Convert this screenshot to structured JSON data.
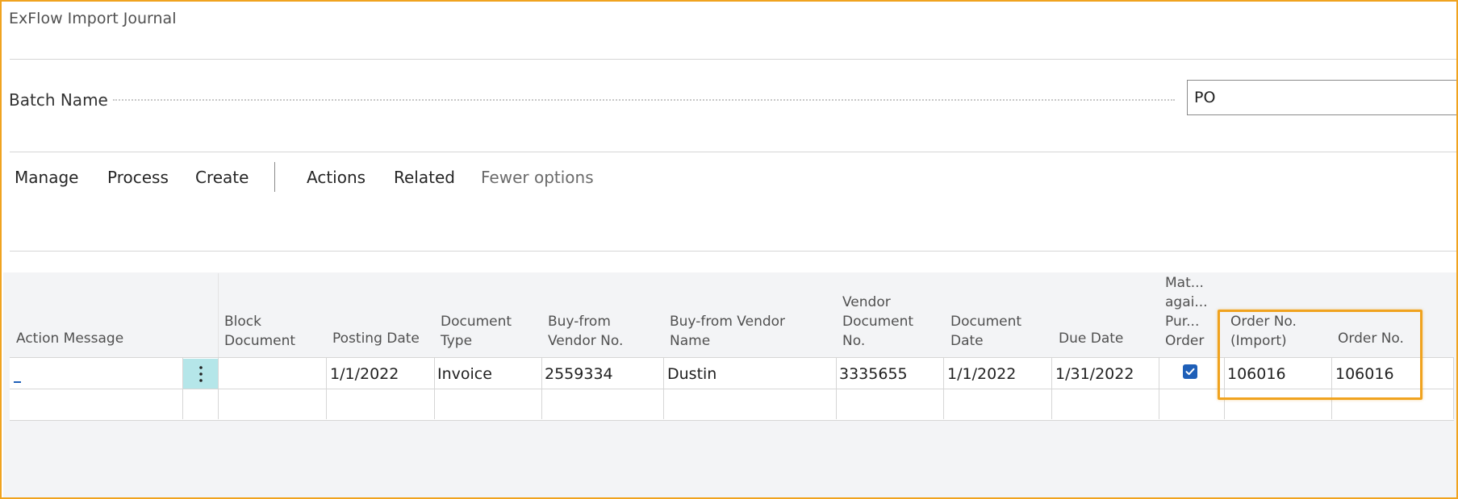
{
  "page": {
    "title": "ExFlow Import Journal"
  },
  "batch": {
    "label": "Batch Name",
    "value": "PO"
  },
  "menu": {
    "items": [
      "Manage",
      "Process",
      "Create",
      "Actions",
      "Related"
    ],
    "fewer_options": "Fewer options"
  },
  "grid": {
    "columns": [
      {
        "lines": [
          "Action Message"
        ]
      },
      {
        "lines": [
          "Block",
          "Document"
        ]
      },
      {
        "lines": [
          "Posting Date"
        ]
      },
      {
        "lines": [
          "Document",
          "Type"
        ]
      },
      {
        "lines": [
          "Buy-from",
          "Vendor No."
        ]
      },
      {
        "lines": [
          "Buy-from Vendor",
          "Name"
        ]
      },
      {
        "lines": [
          "Vendor",
          "Document",
          "No."
        ]
      },
      {
        "lines": [
          "Document",
          "Date"
        ]
      },
      {
        "lines": [
          "Due Date"
        ]
      },
      {
        "lines": [
          "Mat...",
          "agai...",
          "Pur...",
          "Order"
        ]
      },
      {
        "lines": [
          "Order No.",
          "(Import)"
        ]
      },
      {
        "lines": [
          "Order No."
        ]
      }
    ],
    "row": {
      "action_message": "",
      "block_document": "",
      "posting_date": "1/1/2022",
      "document_type": "Invoice",
      "vendor_no": "2559334",
      "vendor_name": "Dustin",
      "vendor_document_no": "3335655",
      "document_date": "1/1/2022",
      "due_date": "1/31/2022",
      "matched_against_po": true,
      "order_no_import": "106016",
      "order_no": "106016"
    }
  },
  "colors": {
    "highlight": "#f0a31f",
    "checkbox": "#1e5fb8",
    "row_action_button": "#b5e6e9"
  },
  "icons": {
    "row_actions": "vertical-ellipsis-icon",
    "checkbox": "checkmark-icon"
  }
}
